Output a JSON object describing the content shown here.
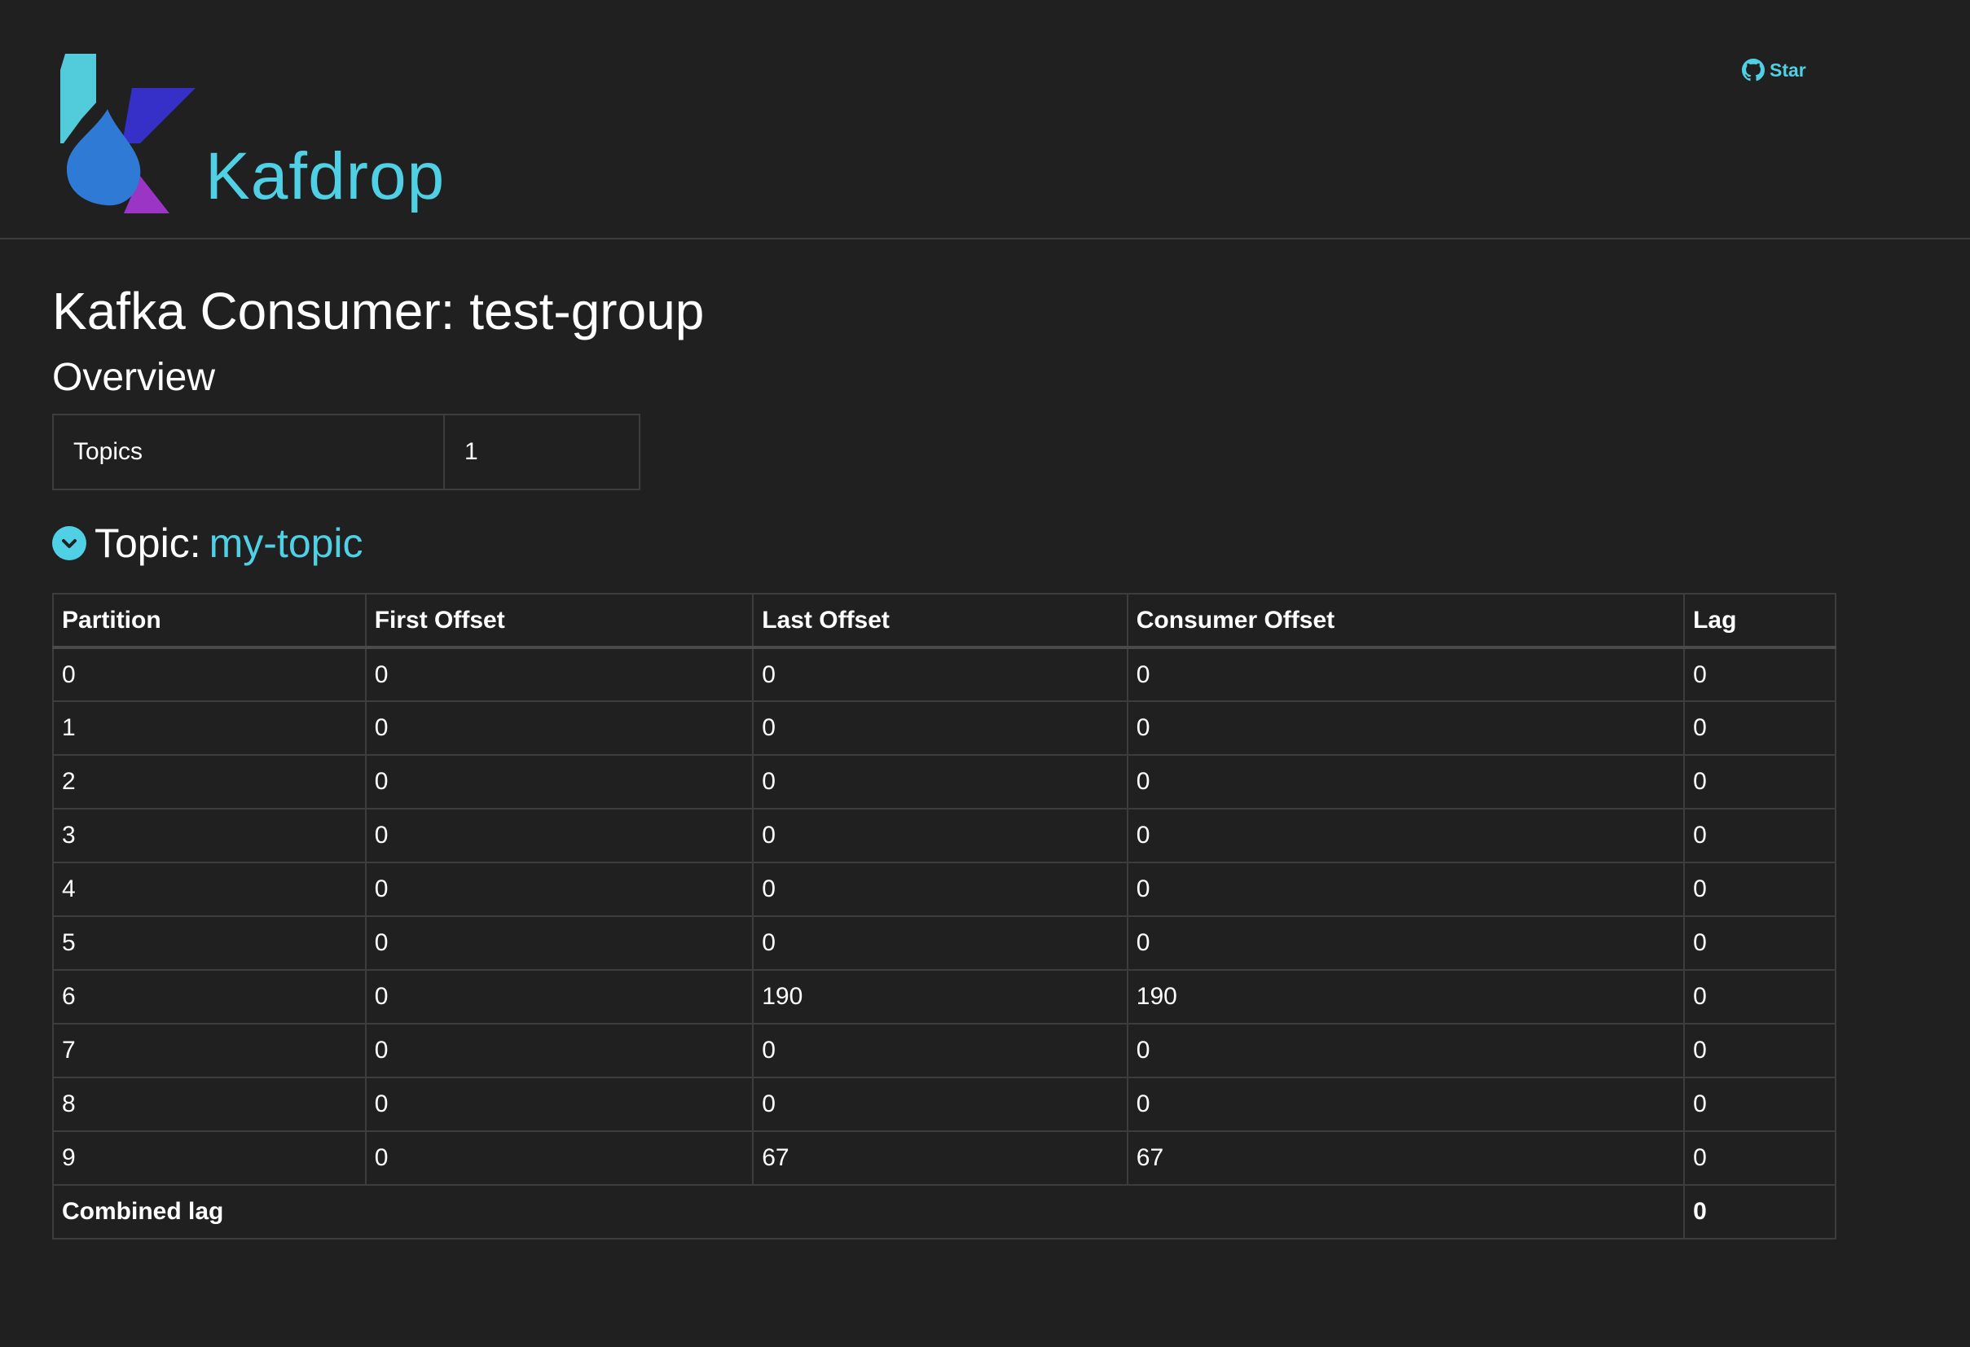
{
  "header": {
    "brand": "Kafdrop",
    "star_label": "Star",
    "icons": {
      "logo": "kafdrop-logo",
      "github": "github-icon"
    },
    "colors": {
      "accent": "#4fd0e5",
      "background": "#202020"
    }
  },
  "page": {
    "title": "Kafka Consumer: test-group",
    "overview_heading": "Overview"
  },
  "overview": {
    "rows": [
      {
        "label": "Topics",
        "value": "1"
      }
    ]
  },
  "topic": {
    "prefix": "Topic:",
    "name": "my-topic",
    "toggle_icon": "chevron-down-circle-icon"
  },
  "partitions": {
    "headers": [
      "Partition",
      "First Offset",
      "Last Offset",
      "Consumer Offset",
      "Lag"
    ],
    "rows": [
      [
        "0",
        "0",
        "0",
        "0",
        "0"
      ],
      [
        "1",
        "0",
        "0",
        "0",
        "0"
      ],
      [
        "2",
        "0",
        "0",
        "0",
        "0"
      ],
      [
        "3",
        "0",
        "0",
        "0",
        "0"
      ],
      [
        "4",
        "0",
        "0",
        "0",
        "0"
      ],
      [
        "5",
        "0",
        "0",
        "0",
        "0"
      ],
      [
        "6",
        "0",
        "190",
        "190",
        "0"
      ],
      [
        "7",
        "0",
        "0",
        "0",
        "0"
      ],
      [
        "8",
        "0",
        "0",
        "0",
        "0"
      ],
      [
        "9",
        "0",
        "67",
        "67",
        "0"
      ]
    ],
    "combined_label": "Combined lag",
    "combined_value": "0"
  }
}
